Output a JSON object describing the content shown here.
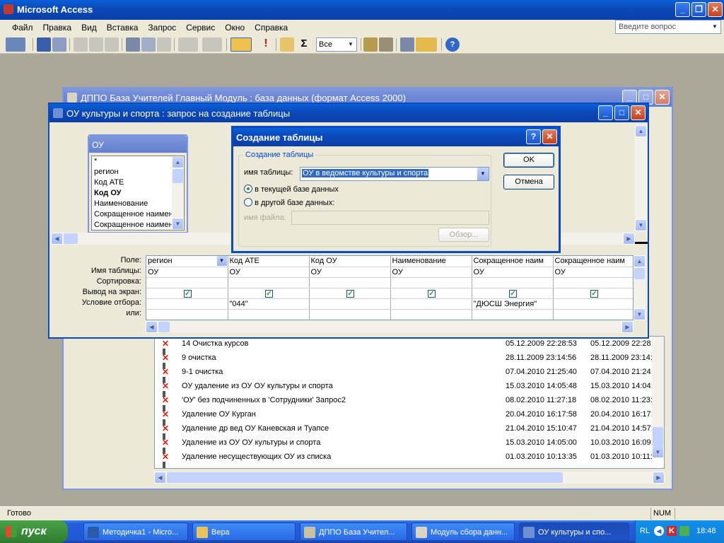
{
  "app": {
    "title": "Microsoft Access",
    "help_placeholder": "Введите вопрос"
  },
  "menu": [
    "Файл",
    "Правка",
    "Вид",
    "Вставка",
    "Запрос",
    "Сервис",
    "Окно",
    "Справка"
  ],
  "toolbar": {
    "top_values": "Все"
  },
  "db_window": {
    "title": "ДППО База Учителей Главный Модуль  : база данных (формат Access 2000)",
    "queries": [
      {
        "name": "14 Очистка курсов",
        "modified": "05.12.2009 22:28:53",
        "created": "05.12.2009 22:28:5"
      },
      {
        "name": "9 очистка",
        "modified": "28.11.2009 23:14:56",
        "created": "28.11.2009 23:14:5"
      },
      {
        "name": "9-1 очистка",
        "modified": "07.04.2010 21:25:40",
        "created": "07.04.2010 21:24:"
      },
      {
        "name": "ОУ  удаление из ОУ ОУ  культуры и спорта",
        "modified": "15.03.2010 14:05:48",
        "created": "15.03.2010 14:04:"
      },
      {
        "name": "'ОУ' без подчиненных в 'Сотрудники' Запрос2",
        "modified": "08.02.2010 11:27:18",
        "created": "08.02.2010 11:23:"
      },
      {
        "name": "Удаление  ОУ Курган",
        "modified": "20.04.2010 16:17:58",
        "created": "20.04.2010 16:17:"
      },
      {
        "name": "Удаление др вед ОУ Каневская и Туапсе",
        "modified": "21.04.2010 15:10:47",
        "created": "21.04.2010 14:57:"
      },
      {
        "name": "Удаление из ОУ ОУ культуры и спорта",
        "modified": "15.03.2010 14:05:00",
        "created": "10.03.2010 16:09:"
      },
      {
        "name": "Удаление несуществующих ОУ из списка",
        "modified": "01.03.2010 10:13:35",
        "created": "01.03.2010 10:11:"
      }
    ]
  },
  "query_window": {
    "title": "ОУ культуры и спорта : запрос на создание таблицы",
    "field_list": {
      "title": "ОУ",
      "fields": [
        {
          "name": "*",
          "bold": false
        },
        {
          "name": "регион",
          "bold": false
        },
        {
          "name": "Код АТЕ",
          "bold": false
        },
        {
          "name": "Код ОУ",
          "bold": true
        },
        {
          "name": "Наименование",
          "bold": false
        },
        {
          "name": "Сокращенное наимен",
          "bold": false
        },
        {
          "name": "Сокращенное наимен",
          "bold": false
        }
      ]
    },
    "row_labels": [
      "Поле:",
      "Имя таблицы:",
      "Сортировка:",
      "Вывод на экран:",
      "Условие отбора:",
      "или:"
    ],
    "columns": [
      {
        "field": "регион",
        "table": "ОУ",
        "sort": "",
        "show": true,
        "criteria": "",
        "or": ""
      },
      {
        "field": "Код АТЕ",
        "table": "ОУ",
        "sort": "",
        "show": true,
        "criteria": "\"044\"",
        "or": ""
      },
      {
        "field": "Код ОУ",
        "table": "ОУ",
        "sort": "",
        "show": true,
        "criteria": "",
        "or": ""
      },
      {
        "field": "Наименование",
        "table": "ОУ",
        "sort": "",
        "show": true,
        "criteria": "",
        "or": ""
      },
      {
        "field": "Сокращенное наим",
        "table": "ОУ",
        "sort": "",
        "show": true,
        "criteria": "\"ДЮСШ Энергия\"",
        "or": ""
      },
      {
        "field": "Сокращенное наим",
        "table": "ОУ",
        "sort": "",
        "show": true,
        "criteria": "",
        "or": ""
      }
    ]
  },
  "dialog": {
    "title": "Создание таблицы",
    "group_label": "Создание таблицы",
    "table_name_label": "имя таблицы:",
    "table_name_value": "ОУ в ведомстве культуры и спорта",
    "radio_current": "в текущей базе данных",
    "radio_other": "в другой базе данных:",
    "file_name_label": "имя файла:",
    "file_name_value": "",
    "ok": "OK",
    "cancel": "Отмена",
    "browse": "Обзор...",
    "help": "?"
  },
  "status": {
    "left": "Готово",
    "num": "NUM"
  },
  "taskbar": {
    "start": "пуск",
    "tasks": [
      "Методичка1 - Micro...",
      "Вера",
      "ДППО База Учител...",
      "Модуль сбора данн...",
      "ОУ культуры и спо..."
    ],
    "lang": "RL",
    "clock": "18:48"
  },
  "colors": {
    "title_active": "#0a4cc0",
    "title_inactive": "#7d96dd",
    "face": "#ece9d8",
    "workspace": "#aba899"
  }
}
